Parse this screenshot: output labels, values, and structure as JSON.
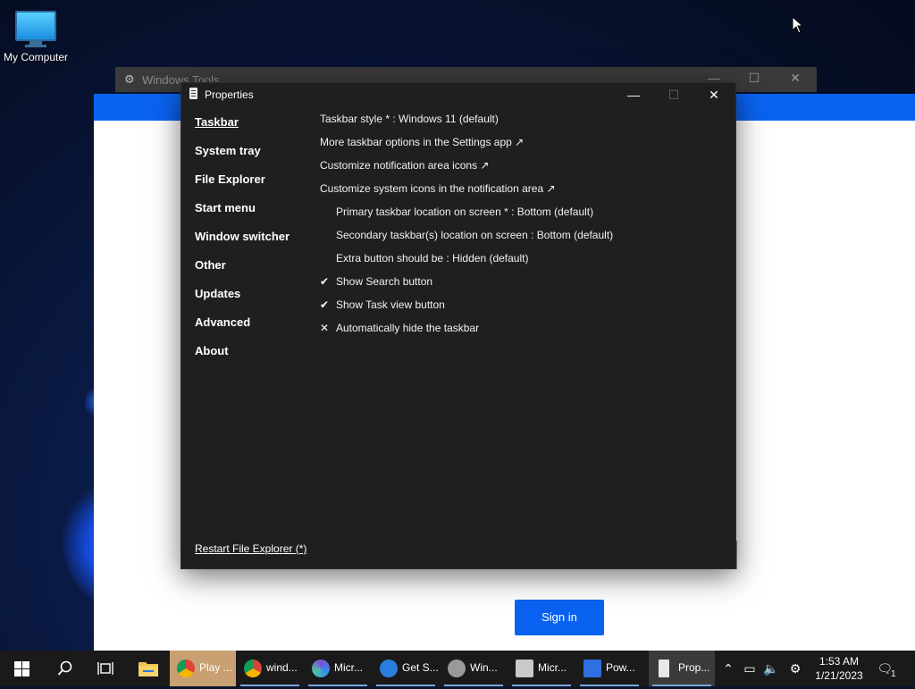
{
  "desktop": {
    "icon_label": "My Computer"
  },
  "windows_tools": {
    "title": "Windows Tools"
  },
  "signin": {
    "button_label": "Sign in"
  },
  "properties": {
    "title": "Properties",
    "nav": [
      {
        "label": "Taskbar",
        "active": true
      },
      {
        "label": "System tray"
      },
      {
        "label": "File Explorer"
      },
      {
        "label": "Start menu"
      },
      {
        "label": "Window switcher"
      },
      {
        "label": "Other"
      },
      {
        "label": "Updates"
      },
      {
        "label": "Advanced"
      },
      {
        "label": "About"
      }
    ],
    "options": [
      {
        "text": "Taskbar style * : Windows 11 (default)",
        "indent": false,
        "mark": ""
      },
      {
        "text": "More taskbar options in the Settings app ↗",
        "indent": false,
        "mark": ""
      },
      {
        "text": "Customize notification area icons ↗",
        "indent": false,
        "mark": ""
      },
      {
        "text": "Customize system icons in the notification area ↗",
        "indent": false,
        "mark": ""
      },
      {
        "text": "Primary taskbar location on screen * : Bottom (default)",
        "indent": true,
        "mark": ""
      },
      {
        "text": "Secondary taskbar(s) location on screen : Bottom (default)",
        "indent": true,
        "mark": ""
      },
      {
        "text": "Extra button should be : Hidden (default)",
        "indent": true,
        "mark": ""
      },
      {
        "text": "Show Search button",
        "indent": true,
        "mark": "✔"
      },
      {
        "text": "Show Task view button",
        "indent": true,
        "mark": "✔"
      },
      {
        "text": "Automatically hide the taskbar",
        "indent": true,
        "mark": "✕"
      }
    ],
    "restart_link": "Restart File Explorer (*)"
  },
  "taskbar": {
    "apps": [
      {
        "label": "Play ...",
        "icon": "chrome-icon"
      },
      {
        "label": "wind...",
        "icon": "chrome-icon"
      },
      {
        "label": "Micr...",
        "icon": "edge-dev-icon"
      },
      {
        "label": "Get S...",
        "icon": "get-started-icon"
      },
      {
        "label": "Win...",
        "icon": "gear-icon"
      },
      {
        "label": "Micr...",
        "icon": "server-manager-icon"
      },
      {
        "label": "Pow...",
        "icon": "powershell-icon"
      },
      {
        "label": "Prop...",
        "icon": "properties-icon"
      }
    ],
    "time": "1:53 AM",
    "date": "1/21/2023",
    "notification_count": "1"
  }
}
